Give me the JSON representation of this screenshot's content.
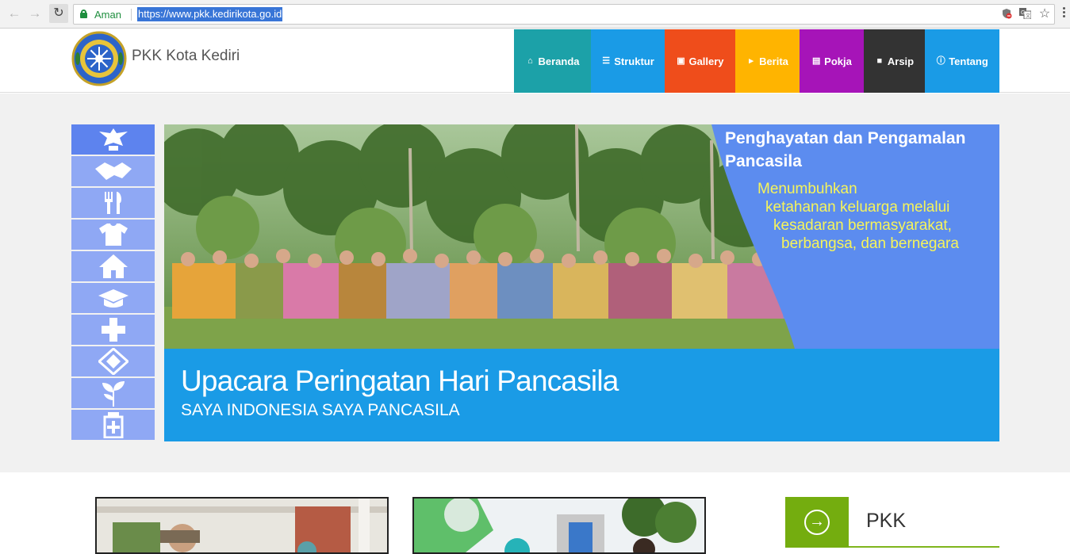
{
  "browser": {
    "secure_label": "Aman",
    "url": "https://www.pkk.kedirikota.go.id",
    "icons": [
      "back-icon",
      "forward-icon",
      "reload-icon",
      "lock-icon",
      "block-icon",
      "translate-icon",
      "star-icon",
      "menu-icon"
    ]
  },
  "site": {
    "title": "PKK Kota Kediri",
    "menu": [
      {
        "label": "Beranda",
        "icon": "home-icon",
        "color": "#1ca1a8"
      },
      {
        "label": "Struktur",
        "icon": "list-icon",
        "color": "#1a9be6"
      },
      {
        "label": "Gallery",
        "icon": "image-icon",
        "color": "#ef4d1b"
      },
      {
        "label": "Berita",
        "icon": "megaphone-icon",
        "color": "#ffb400"
      },
      {
        "label": "Pokja",
        "icon": "document-icon",
        "color": "#a614b8"
      },
      {
        "label": "Arsip",
        "icon": "book-icon",
        "color": "#333333"
      },
      {
        "label": "Tentang",
        "icon": "info-icon",
        "color": "#1a9be6"
      }
    ]
  },
  "side_icons": [
    "garuda-icon",
    "handshake-icon",
    "food-icon",
    "shirt-icon",
    "house-icon",
    "graduation-cap-icon",
    "health-cross-icon",
    "cooperative-icon",
    "plant-icon",
    "medicine-icon"
  ],
  "slide": {
    "heading": "Penghayatan dan Pengamalan Pancasila",
    "subtext": [
      "Menumbuhkan",
      "ketahanan keluarga melalui",
      "kesadaran bermasyarakat,",
      "berbangsa, dan bernegara"
    ],
    "caption_title": "Upacara Peringatan Hari Pancasila",
    "caption_sub": "SAYA INDONESIA SAYA PANCASILA"
  },
  "sidebar_box": {
    "title": "PKK",
    "icon": "arrow-circle-right-icon"
  }
}
